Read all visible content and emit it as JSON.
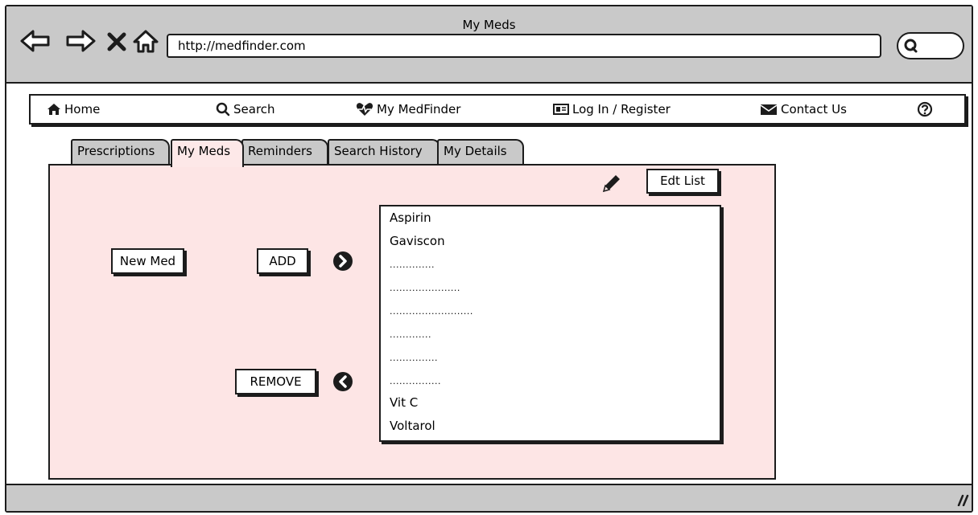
{
  "window": {
    "title": "My Meds"
  },
  "browser": {
    "url": "http://medfinder.com"
  },
  "menu": {
    "home_label": "Home",
    "search_label": "Search",
    "medfinder_label": "My MedFinder",
    "login_label": "Log In / Register",
    "contact_label": "Contact Us"
  },
  "tabs": [
    {
      "label": "Prescriptions"
    },
    {
      "label": "My Meds",
      "active": true
    },
    {
      "label": "Reminders"
    },
    {
      "label": "Search History"
    },
    {
      "label": "My Details"
    }
  ],
  "panel": {
    "edit_list_label": "Edt List",
    "new_med_label": "New Med",
    "add_label": "ADD",
    "remove_label": "REMOVE"
  },
  "med_list": {
    "items": [
      "Aspirin",
      "Gaviscon",
      "..............",
      "......................",
      "..........................",
      ".............",
      "...............",
      "................",
      "Vit C",
      "Voltarol"
    ]
  },
  "colors": {
    "panel_bg": "#fde5e5",
    "chrome_bg": "#c9c9c9",
    "ink": "#1c1c1c"
  }
}
